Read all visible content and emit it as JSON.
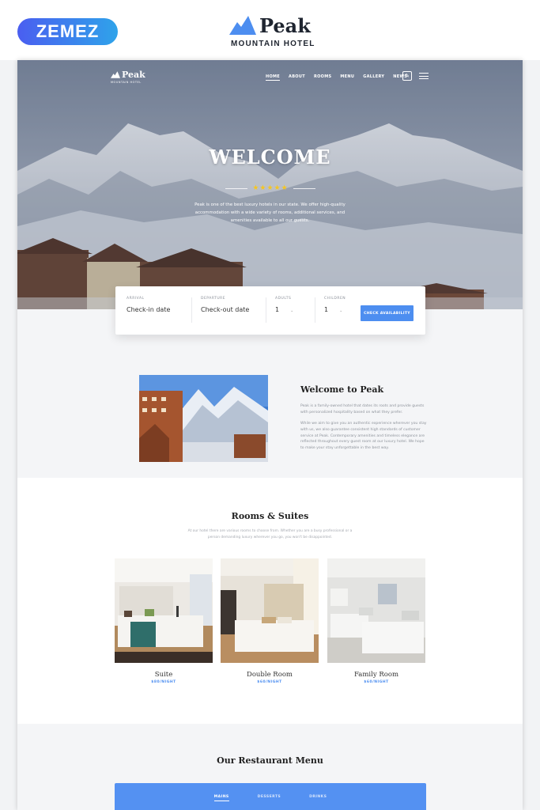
{
  "promo": {
    "badge": "ZEMEZ",
    "brand_name": "Peak",
    "brand_sub": "MOUNTAIN HOTEL"
  },
  "nav": {
    "logo_name": "Peak",
    "logo_sub": "MOUNTAIN HOTEL",
    "items": [
      "HOME",
      "ABOUT",
      "ROOMS",
      "MENU",
      "GALLERY",
      "NEWS"
    ],
    "active_index": 0
  },
  "hero": {
    "title": "WELCOME",
    "stars": "★★★★★",
    "intro": "Peak is one of the best luxury hotels in our state. We offer high-quality accommodation with a wide variety of rooms, additional services, and amenities available to all our guests."
  },
  "booking": {
    "arrival_label": "ARRIVAL",
    "arrival_value": "Check-in date",
    "departure_label": "DEPARTURE",
    "departure_value": "Check-out date",
    "adults_label": "ADULTS",
    "adults_value": "1",
    "children_label": "CHILDREN",
    "children_value": "1",
    "button": "CHECK AVAILABILITY"
  },
  "about": {
    "title": "Welcome to Peak",
    "p1": "Peak is a family-owned hotel that dates its roots and provide guests with personalized hospitality based on what they prefer.",
    "p2": "While we aim to give you an authentic experience wherever you stay with us, we also guarantee consistent high standards of customer service at Peak. Contemporary amenities and timeless elegance are reflected throughout every guest room at our luxury hotel. We hope to make your stay unforgettable in the best way."
  },
  "rooms": {
    "title": "Rooms & Suites",
    "subtitle": "At our hotel there are various rooms to choose from. Whether you are a busy professional or a person demanding luxury wherever you go, you won't be disappointed.",
    "items": [
      {
        "name": "Suite",
        "price": "$80/NIGHT"
      },
      {
        "name": "Double Room",
        "price": "$60/NIGHT"
      },
      {
        "name": "Family Room",
        "price": "$60/NIGHT"
      }
    ]
  },
  "restaurant": {
    "title": "Our Restaurant Menu",
    "tabs": [
      "MAINS",
      "DESSERTS",
      "DRINKS"
    ],
    "active_index": 0
  },
  "colors": {
    "accent": "#4d8ef0",
    "star": "#f5c623",
    "badge_start": "#4a5ef0",
    "badge_end": "#2fa3ea"
  }
}
